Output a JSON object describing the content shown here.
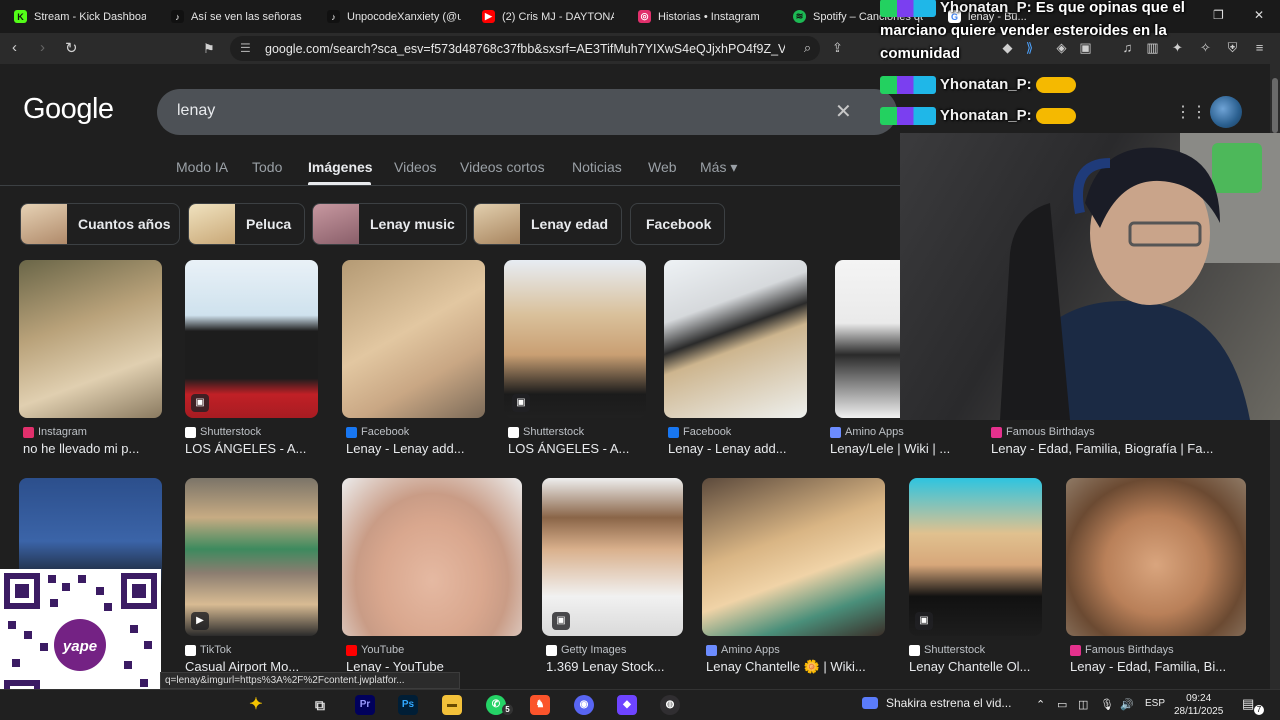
{
  "browser": {
    "tabs": [
      {
        "title": "Stream - Kick Dashboar",
        "icon": "kick-icon",
        "color": "#53fc18",
        "glyph": "K"
      },
      {
        "title": "Así se ven las señoras d",
        "icon": "tiktok-icon",
        "color": "#ffffff",
        "glyph": "♪"
      },
      {
        "title": "UnpocodeXanxiety (@u",
        "icon": "tiktok-icon",
        "color": "#ffffff",
        "glyph": "♪"
      },
      {
        "title": "(2) Cris MJ - DAYTONA",
        "icon": "youtube-icon",
        "color": "#ff0000",
        "glyph": "▶"
      },
      {
        "title": "Historias • Instagram",
        "icon": "instagram-icon",
        "color": "#e1306c",
        "glyph": "◎"
      },
      {
        "title": "Spotify – Canciones que",
        "icon": "spotify-icon",
        "color": "#1db954",
        "glyph": "≋"
      },
      {
        "title": "lenay - Bu...",
        "icon": "google-icon",
        "color": "#ffffff",
        "glyph": "G"
      }
    ],
    "url": "google.com/search?sca_esv=f573d48768c37fbb&sxsrf=AE3TifMuh7YIXwS4eQJjxhPO4f9Z_V9_...",
    "status_url": "q=lenay&imgurl=https%3A%2F%2Fcontent.jwplatfor..."
  },
  "google": {
    "logo": "Google",
    "query": "lenay",
    "tabs": [
      "Modo IA",
      "Todo",
      "Imágenes",
      "Videos",
      "Videos cortos",
      "Noticias",
      "Web",
      "Más ▾"
    ],
    "active_tab": "Imágenes",
    "chips": [
      {
        "label": "Cuantos años",
        "thumb": "#c7a98a"
      },
      {
        "label": "Peluca",
        "thumb": "#d8c190"
      },
      {
        "label": "Lenay music",
        "thumb": "#b98c7a"
      },
      {
        "label": "Lenay edad",
        "thumb": "#cdb08a"
      },
      {
        "label": "Facebook",
        "thumb": ""
      }
    ],
    "row1": [
      {
        "source": "Instagram",
        "title": "no he llevado mi p...",
        "fav": "#e1306c",
        "bg": "linear-gradient(160deg,#6a6648 0%,#b9a27a 40%,#e0cfb0 70%,#8a7a60 100%)",
        "badge": ""
      },
      {
        "source": "Shutterstock",
        "title": "LOS ÁNGELES - A...",
        "fav": "#ffffff",
        "bg": "linear-gradient(180deg,#e9f1f7 0%,#cfe2ee 35%,#1d1d1d 45%,#1d1d1d 75%,#c02026 85%,#a81c22 100%)",
        "badge": "▣"
      },
      {
        "source": "Facebook",
        "title": "Lenay - Lenay add...",
        "fav": "#1877f2",
        "bg": "linear-gradient(150deg,#b49a74 0%,#e2c7a1 45%,#c9a784 70%,#7b6a58 100%)",
        "badge": ""
      },
      {
        "source": "Shutterstock",
        "title": "LOS ÁNGELES - A...",
        "fav": "#ffffff",
        "bg": "linear-gradient(180deg,#e7ecf3 0%,#d9c09a 35%,#c99f73 60%,#1b1b1b 85%,#202020 100%)",
        "badge": "▣"
      },
      {
        "source": "Facebook",
        "title": "Lenay - Lenay add...",
        "fav": "#1877f2",
        "bg": "linear-gradient(160deg,#eef2f5 0%,#d6d9dc 30%,#2a2a2a 45%,#cdb58e 55%,#eef0ee 100%)",
        "badge": ""
      },
      {
        "source": "Amino Apps",
        "title": "Lenay/Lele | Wiki | ...",
        "fav": "#6c8cff",
        "bg": "linear-gradient(180deg,#f4f4f4 0%,#eaeaea 40%,#2a2a2a 60%,#f0f0f0 100%)",
        "badge": ""
      },
      {
        "source": "Famous Birthdays",
        "title": "Lenay - Edad, Familia, Biografía | Fa...",
        "fav": "#e5318d",
        "bg": "",
        "badge": ""
      }
    ],
    "row2": [
      {
        "source": "",
        "title": "",
        "fav": "",
        "bg": "linear-gradient(180deg,#2c4f8c 0%,#3b64a8 40%,#151515 70%,#1a1a1a 100%)",
        "badge": ""
      },
      {
        "source": "TikTok",
        "title": "Casual Airport Mo...",
        "fav": "#ffffff",
        "bg": "linear-gradient(180deg,#7b7468 0%,#c7ab83 25%,#3d8a5e 45%,#8b7d70 60%,#d8bb93 80%,#2b2b2b 100%)",
        "badge": "▶"
      },
      {
        "source": "YouTube",
        "title": "Lenay - YouTube",
        "fav": "#ff0000",
        "bg": "radial-gradient(ellipse at 50% 65%,#e5b9a2 0%,#d9a78e 40%,#c99c86 60%,#ececec 100%)",
        "badge": ""
      },
      {
        "source": "Getty Images",
        "title": "1.369 Lenay Stock...",
        "fav": "#ffffff",
        "bg": "linear-gradient(180deg,#eeeeee 0%,#8a6548 25%,#d9b08c 45%,#f1f1f1 75%,#dadada 100%)",
        "badge": "▣"
      },
      {
        "source": "Amino Apps",
        "title": "Lenay Chantelle 🌼 | Wiki...",
        "fav": "#6c8cff",
        "bg": "linear-gradient(160deg,#5c4a3c 0%,#d9b584 40%,#f0d3a7 60%,#4a8f7a 80%,#3a2e28 100%)",
        "badge": ""
      },
      {
        "source": "Shutterstock",
        "title": "Lenay Chantelle Ol...",
        "fav": "#ffffff",
        "bg": "linear-gradient(180deg,#2ec4e0 0%,#e0c18f 35%,#d7a77a 55%,#111111 75%,#1d1d1d 100%)",
        "badge": "▣"
      },
      {
        "source": "Famous Birthdays",
        "title": "Lenay - Edad, Familia, Bi...",
        "fav": "#e5318d",
        "bg": "radial-gradient(ellipse at 50% 55%,#d9a57e 0%,#b98059 40%,#6b4a32 70%,#8f7a66 100%)",
        "badge": ""
      }
    ]
  },
  "chat": [
    {
      "user": "Yhonatan_P:",
      "message": "Es que opinas que el marciano quiere vender esteroides en la comunidad"
    },
    {
      "user": "Yhonatan_P:",
      "message": ""
    },
    {
      "user": "Yhonatan_P:",
      "message": ""
    }
  ],
  "taskbar": {
    "notification": "Shakira estrena el vid...",
    "language": "ESP",
    "time": "09:24",
    "date": "28/11/2025",
    "notif_count": "7",
    "whatsapp_count": "5"
  }
}
